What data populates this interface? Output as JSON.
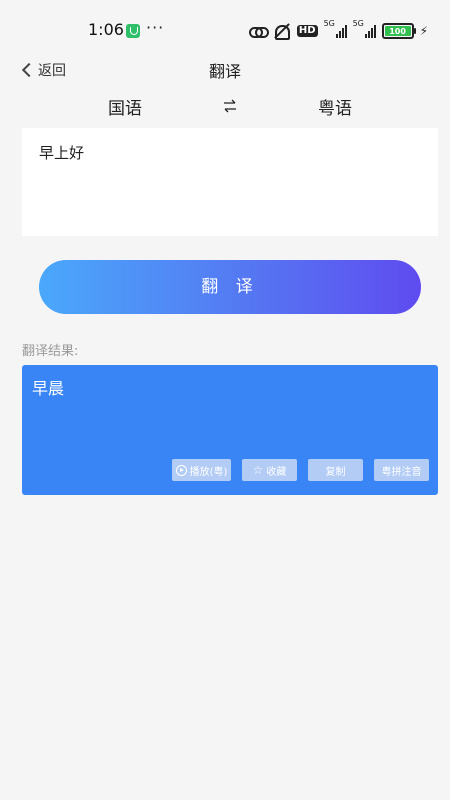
{
  "status_bar": {
    "time": "1:06",
    "dots": "···",
    "hd_label": "HD",
    "network_label_1": "5G",
    "network_label_2": "5G",
    "battery": "100",
    "icons": [
      "shield-icon",
      "link-icon",
      "mute-icon",
      "signal-icon",
      "battery-icon",
      "bolt-icon"
    ]
  },
  "nav": {
    "back_label": "返回",
    "title": "翻译"
  },
  "languages": {
    "source": "国语",
    "target": "粤语",
    "swap_icon": "swap-icon"
  },
  "input": {
    "value": "早上好"
  },
  "translate_button": {
    "label": "翻 译"
  },
  "result": {
    "label": "翻译结果:",
    "text": "早晨",
    "actions": {
      "play": "播放(粤)",
      "favorite": "收藏",
      "copy": "复制",
      "pinyin": "粤拼注音"
    }
  },
  "colors": {
    "background": "#f5f5f5",
    "result_card": "#3a85f5",
    "button_gradient_start": "#4aa8fb",
    "button_gradient_end": "#5f4bf0",
    "battery": "#31c04f"
  }
}
